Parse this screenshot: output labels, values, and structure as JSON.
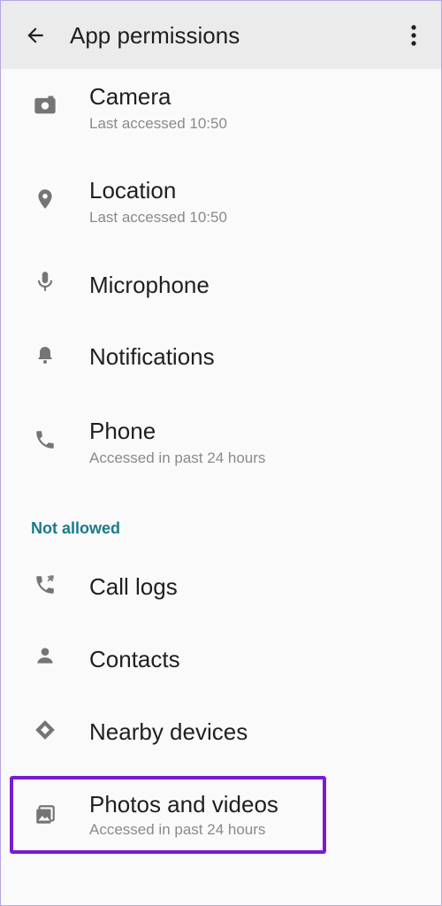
{
  "header": {
    "back_icon": "arrow-left-icon",
    "title": "App permissions",
    "more_icon": "more-vertical-icon"
  },
  "allowed": [
    {
      "icon": "camera-icon",
      "label": "Camera",
      "sub": "Last accessed 10:50"
    },
    {
      "icon": "location-pin-icon",
      "label": "Location",
      "sub": "Last accessed 10:50"
    },
    {
      "icon": "microphone-icon",
      "label": "Microphone",
      "sub": ""
    },
    {
      "icon": "bell-icon",
      "label": "Notifications",
      "sub": ""
    },
    {
      "icon": "phone-icon",
      "label": "Phone",
      "sub": "Accessed in past 24 hours"
    }
  ],
  "not_allowed_header": "Not allowed",
  "not_allowed": [
    {
      "icon": "call-log-icon",
      "label": "Call logs",
      "sub": ""
    },
    {
      "icon": "person-icon",
      "label": "Contacts",
      "sub": ""
    },
    {
      "icon": "nearby-devices-icon",
      "label": "Nearby devices",
      "sub": ""
    },
    {
      "icon": "image-gallery-icon",
      "label": "Photos and videos",
      "sub": "Accessed in past 24 hours"
    }
  ],
  "colors": {
    "header_bg": "#ebebeb",
    "section_accent": "#1a7a8c",
    "highlight": "#7a1ad2",
    "icon": "#757575"
  }
}
